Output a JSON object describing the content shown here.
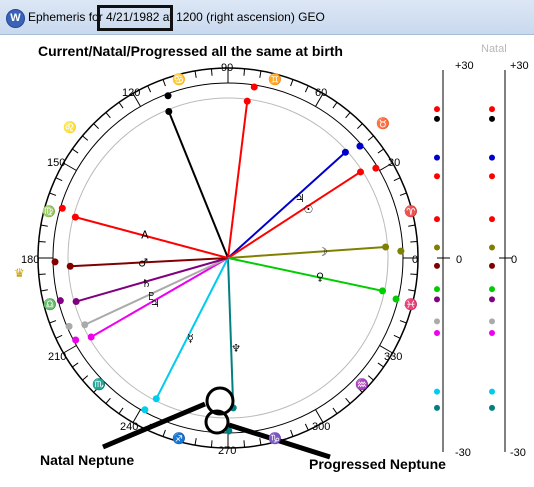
{
  "window": {
    "title": "Ephemeris for 4/21/1982 at 1200 (right ascension) GEO",
    "icon": "w-logo-icon"
  },
  "heading": "Current/Natal/Progressed all the same at birth",
  "wheel": {
    "degree_labels": [
      "90",
      "120",
      "60",
      "150",
      "30",
      "180",
      "0",
      "210",
      "330",
      "240",
      "300",
      "270"
    ],
    "sign_glyphs": [
      "♋",
      "♊",
      "♌",
      "♉",
      "♍",
      "♈",
      "♎",
      "♓",
      "♏",
      "♒",
      "♐",
      "♑"
    ],
    "crown_icon": "crown-icon"
  },
  "scales": {
    "header": "Natal",
    "left": {
      "top": "+30",
      "mid": "0",
      "bottom": "-30"
    },
    "right": {
      "top": "+30",
      "mid": "0",
      "bottom": "-30"
    }
  },
  "annotations": {
    "natal": "Natal Neptune",
    "progressed": "Progressed Neptune"
  },
  "planets": [
    {
      "name": "Moon-node-black",
      "color": "#000000",
      "glyph": "",
      "angle": 112
    },
    {
      "name": "red-square",
      "color": "#ff0000",
      "glyph": "",
      "angle": 83
    },
    {
      "name": "blue",
      "color": "#0000cc",
      "glyph": "♃",
      "angle": 42
    },
    {
      "name": "red-2",
      "color": "#ff0000",
      "glyph": "☉",
      "angle": 33
    },
    {
      "name": "olive",
      "color": "#808000",
      "glyph": "☽",
      "angle": 4
    },
    {
      "name": "green",
      "color": "#00cc00",
      "glyph": "♀",
      "angle": -12
    },
    {
      "name": "teal",
      "color": "#008080",
      "glyph": "♆",
      "angle": -88
    },
    {
      "name": "cyan",
      "color": "#00ccee",
      "glyph": "☿",
      "angle": -117
    },
    {
      "name": "magenta",
      "color": "#ee00ee",
      "glyph": "♃",
      "angle": -150
    },
    {
      "name": "grey",
      "color": "#aaaaaa",
      "glyph": "♇",
      "angle": -155
    },
    {
      "name": "purple",
      "color": "#800080",
      "glyph": "♄",
      "angle": -164
    },
    {
      "name": "darkred",
      "color": "#800000",
      "glyph": "♂",
      "angle": -177
    },
    {
      "name": "red-triangle",
      "color": "#ff0000",
      "glyph": "A",
      "angle": 165
    }
  ]
}
